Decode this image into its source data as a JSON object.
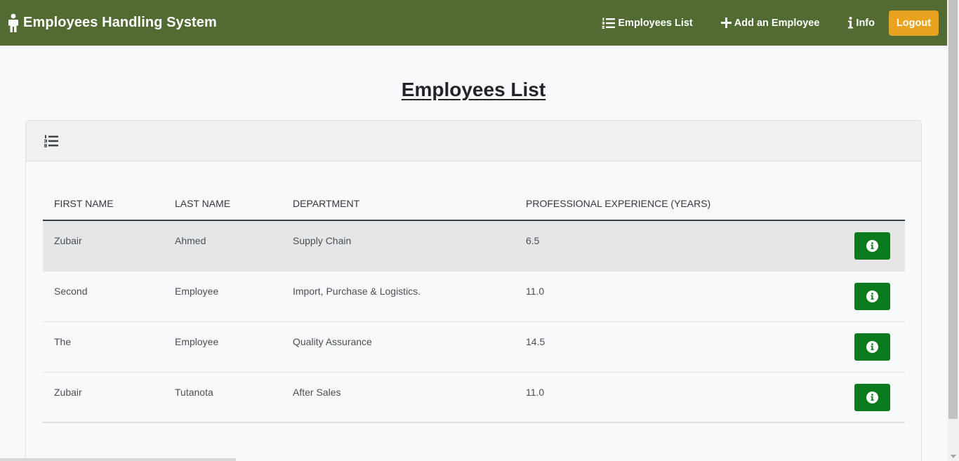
{
  "app": {
    "title": "Employees Handling System",
    "brand_color": "#526b33",
    "accent_color": "#e9a31e",
    "action_color": "#0a7a1f"
  },
  "nav": {
    "employees_list_label": "Employees List",
    "add_employee_label": "Add an Employee",
    "info_label": "Info",
    "logout_label": "Logout"
  },
  "page": {
    "title": "Employees List"
  },
  "table": {
    "headers": [
      "FIRST NAME",
      "LAST NAME",
      "DEPARTMENT",
      "PROFESSIONAL EXPERIENCE (YEARS)"
    ],
    "rows": [
      {
        "first_name": "Zubair",
        "last_name": "Ahmed",
        "department": "Supply Chain",
        "experience": "6.5"
      },
      {
        "first_name": "Second",
        "last_name": "Employee",
        "department": "Import, Purchase & Logistics.",
        "experience": "11.0"
      },
      {
        "first_name": "The",
        "last_name": "Employee",
        "department": "Quality Assurance",
        "experience": "14.5"
      },
      {
        "first_name": "Zubair",
        "last_name": "Tutanota",
        "department": "After Sales",
        "experience": "11.0"
      }
    ]
  },
  "icons": {
    "brand": "person-icon",
    "list": "list-ol-icon",
    "add": "plus-icon",
    "info": "info-icon",
    "row_action": "info-circle-icon"
  }
}
